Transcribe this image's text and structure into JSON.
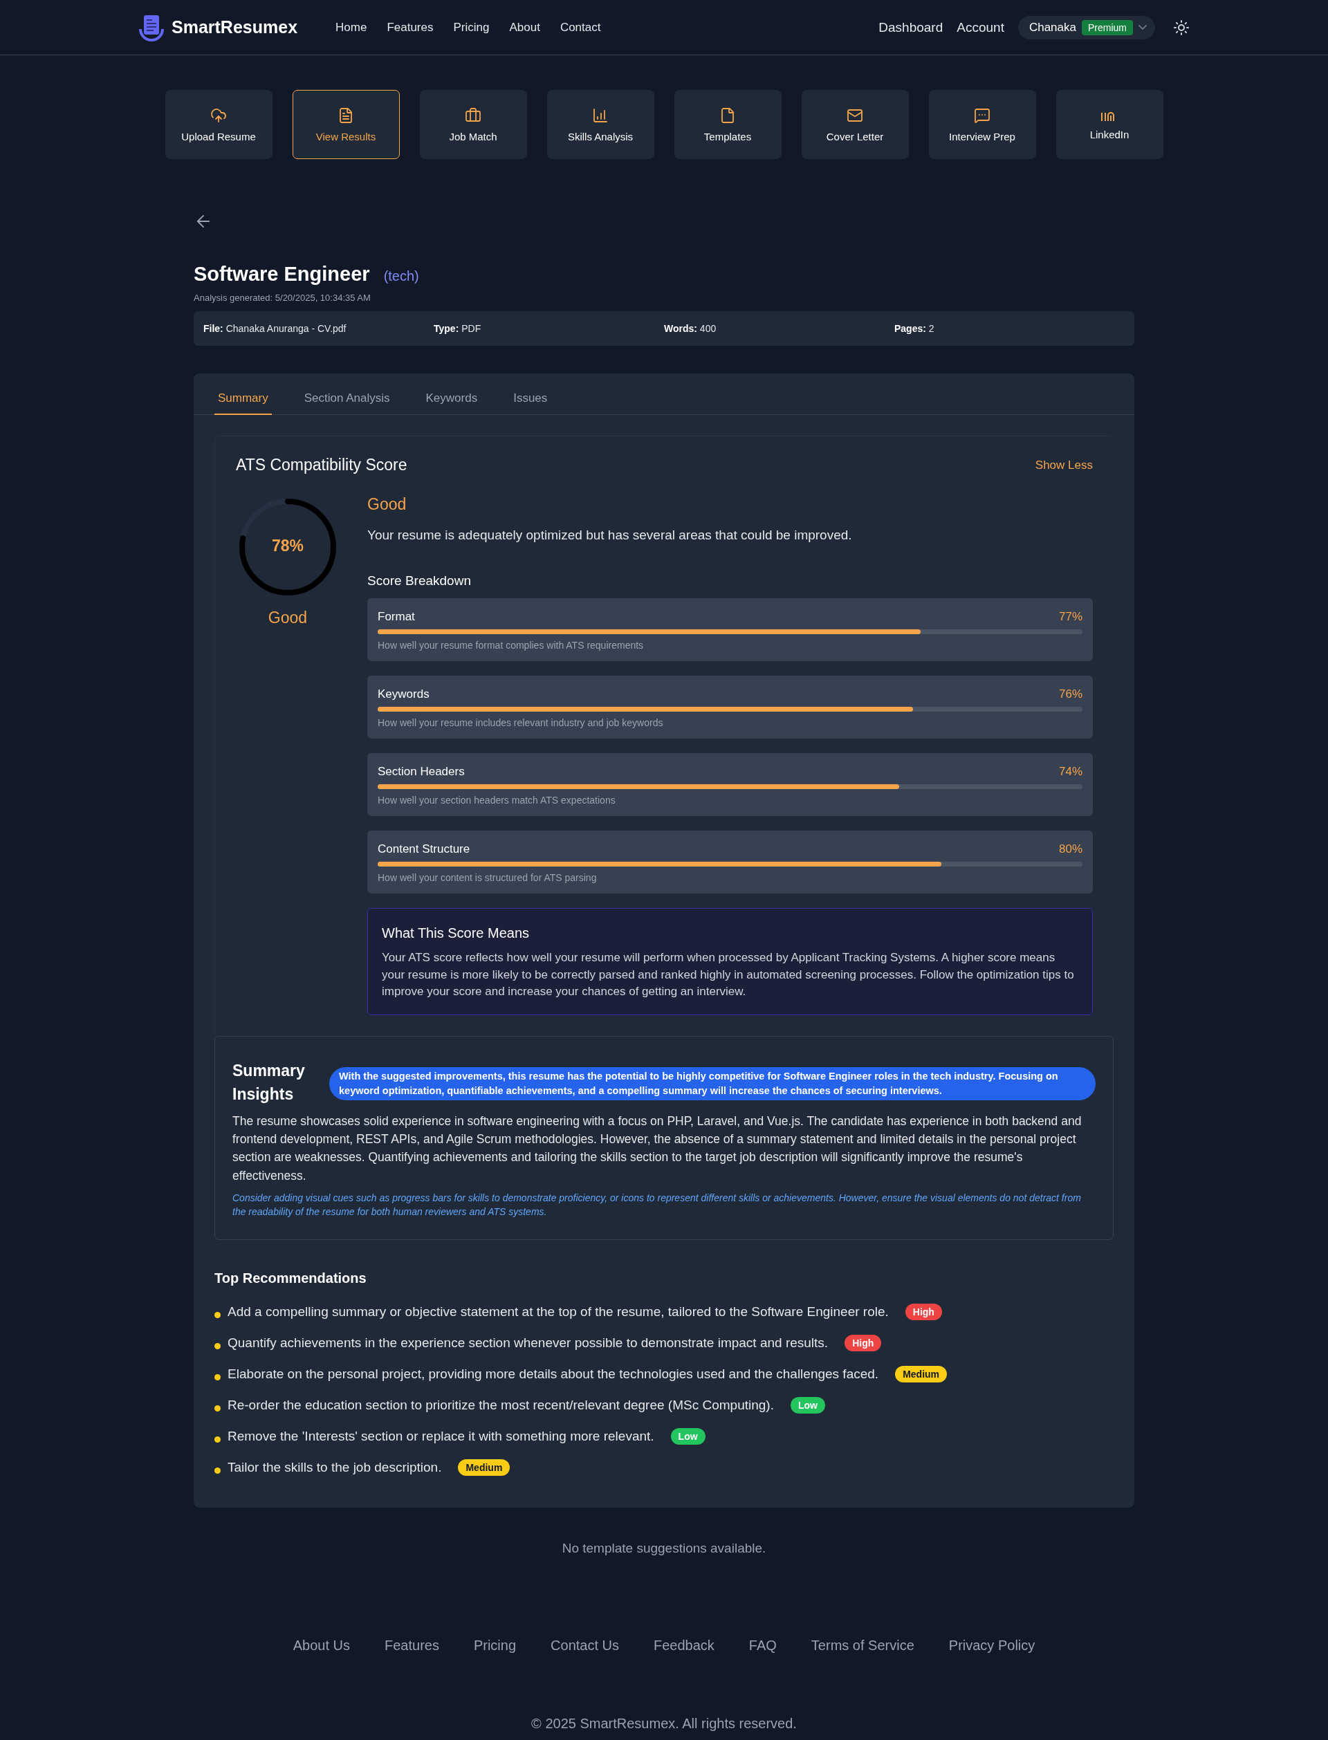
{
  "header": {
    "brand": "SmartResumex",
    "nav": [
      "Home",
      "Features",
      "Pricing",
      "About",
      "Contact"
    ],
    "right_links": [
      "Dashboard",
      "Account"
    ],
    "user": {
      "name": "Chanaka",
      "badge": "Premium"
    }
  },
  "quick_actions": [
    {
      "kind": "upload",
      "label": "Upload Resume",
      "selected": false
    },
    {
      "kind": "document",
      "label": "View Results",
      "selected": true
    },
    {
      "kind": "briefcase",
      "label": "Job Match",
      "selected": false
    },
    {
      "kind": "chart",
      "label": "Skills Analysis",
      "selected": false
    },
    {
      "kind": "file",
      "label": "Templates",
      "selected": false
    },
    {
      "kind": "mail",
      "label": "Cover Letter",
      "selected": false
    },
    {
      "kind": "chat",
      "label": "Interview Prep",
      "selected": false
    },
    {
      "kind": "linkedin",
      "label": "LinkedIn",
      "selected": false
    }
  ],
  "title": "Software Engineer",
  "category": "(tech)",
  "generated": "Analysis generated: 5/20/2025, 10:34:35 AM",
  "file_info": [
    {
      "label": "File:",
      "value": "Chanaka Anuranga - CV.pdf"
    },
    {
      "label": "Type:",
      "value": "PDF"
    },
    {
      "label": "Words:",
      "value": "400"
    },
    {
      "label": "Pages:",
      "value": "2"
    }
  ],
  "tabs": [
    {
      "label": "Summary",
      "selected": true
    },
    {
      "label": "Section Analysis",
      "selected": false
    },
    {
      "label": "Keywords",
      "selected": false
    },
    {
      "label": "Issues",
      "selected": false
    }
  ],
  "ats": {
    "title": "ATS Compatibility Score",
    "toggle": "Show Less",
    "score": "78%",
    "level": 0.78,
    "rating": "Good",
    "rating_title": "Good",
    "summary": "Your resume is adequately optimized but has several areas that could be improved.",
    "breakdown_title": "Score Breakdown",
    "breakdown": [
      {
        "name": "Format",
        "reading": "77%",
        "level": 0.77,
        "description": "How well your resume format complies with ATS requirements"
      },
      {
        "name": "Keywords",
        "reading": "76%",
        "level": 0.76,
        "description": "How well your resume includes relevant industry and job keywords"
      },
      {
        "name": "Section Headers",
        "reading": "74%",
        "level": 0.74,
        "description": "How well your section headers match ATS expectations"
      },
      {
        "name": "Content Structure",
        "reading": "80%",
        "level": 0.8,
        "description": "How well your content is structured for ATS parsing"
      }
    ],
    "meaning": {
      "title": "What This Score Means",
      "text": "Your ATS score reflects how well your resume will perform when processed by Applicant Tracking Systems. A higher score means your resume is more likely to be correctly parsed and ranked highly in automated screening processes. Follow the optimization tips to improve your score and increase your chances of getting an interview."
    }
  },
  "insights": {
    "title": "Summary Insights",
    "highlight": "With the suggested improvements, this resume has the potential to be highly competitive for Software Engineer roles in the tech industry. Focusing on keyword optimization, quantifiable achievements, and a compelling summary will increase the chances of securing interviews.",
    "text": "The resume showcases solid experience in software engineering with a focus on PHP, Laravel, and Vue.js. The candidate has experience in both backend and frontend development, REST APIs, and Agile Scrum methodologies. However, the absence of a summary statement and limited details in the personal project section are weaknesses. Quantifying achievements and tailoring the skills section to the target job description will significantly improve the resume's effectiveness.",
    "note": "Consider adding visual cues such as progress bars for skills to demonstrate proficiency, or icons to represent different skills or achievements. However, ensure the visual elements do not detract from the readability of the resume for both human reviewers and ATS systems."
  },
  "recommendations": {
    "title": "Top Recommendations",
    "items": [
      {
        "text": "Add a compelling summary or objective statement at the top of the resume, tailored to the Software Engineer role.",
        "priority": "High",
        "kind": "high"
      },
      {
        "text": "Quantify achievements in the experience section whenever possible to demonstrate impact and results.",
        "priority": "High",
        "kind": "high"
      },
      {
        "text": "Elaborate on the personal project, providing more details about the technologies used and the challenges faced.",
        "priority": "Medium",
        "kind": "medium"
      },
      {
        "text": "Re-order the education section to prioritize the most recent/relevant degree (MSc Computing).",
        "priority": "Low",
        "kind": "low"
      },
      {
        "text": "Remove the 'Interests' section or replace it with something more relevant.",
        "priority": "Low",
        "kind": "low"
      },
      {
        "text": "Tailor the skills to the job description.",
        "priority": "Medium",
        "kind": "medium"
      }
    ]
  },
  "templates_note": "No template suggestions available.",
  "footer": {
    "links": [
      "About Us",
      "Features",
      "Pricing",
      "Contact Us",
      "Feedback",
      "FAQ",
      "Terms of Service",
      "Privacy Policy"
    ],
    "copyright": "© 2025 SmartResumex. All rights reserved."
  }
}
